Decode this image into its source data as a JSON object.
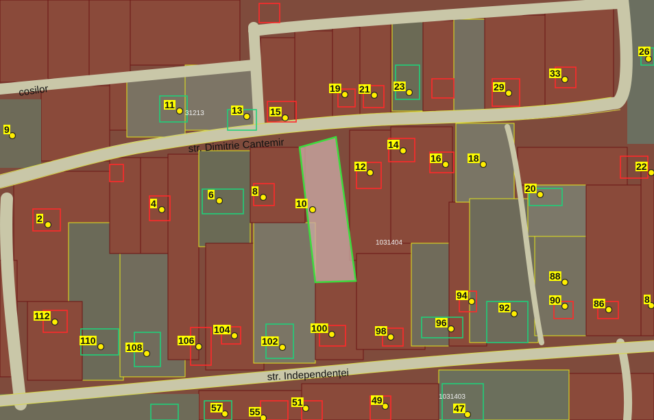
{
  "map": {
    "streets": {
      "cosilor": "cosilor",
      "cantemir": "str. Dimitrie Cantemir",
      "independentei": "str. Independenței"
    },
    "cadastral_ids": {
      "a": "31213",
      "b": "1031404",
      "c": "1031403"
    },
    "house_numbers": [
      "9",
      "11",
      "13",
      "15",
      "19",
      "21",
      "23",
      "29",
      "33",
      "26",
      "2",
      "4",
      "6",
      "8",
      "10",
      "12",
      "14",
      "16",
      "18",
      "22",
      "20",
      "88",
      "90",
      "86",
      "8",
      "94",
      "92",
      "96",
      "98",
      "100",
      "102",
      "104",
      "106",
      "108",
      "110",
      "112",
      "57",
      "55",
      "51",
      "49",
      "47"
    ],
    "colors": {
      "parcel_outline": "#6b1414",
      "boundary_yellow": "#e6e61a",
      "building_red": "#ff2a2a",
      "building_green": "#1fd07a",
      "selected_outline": "#3ddc3d",
      "marker": "#ffee00"
    }
  }
}
